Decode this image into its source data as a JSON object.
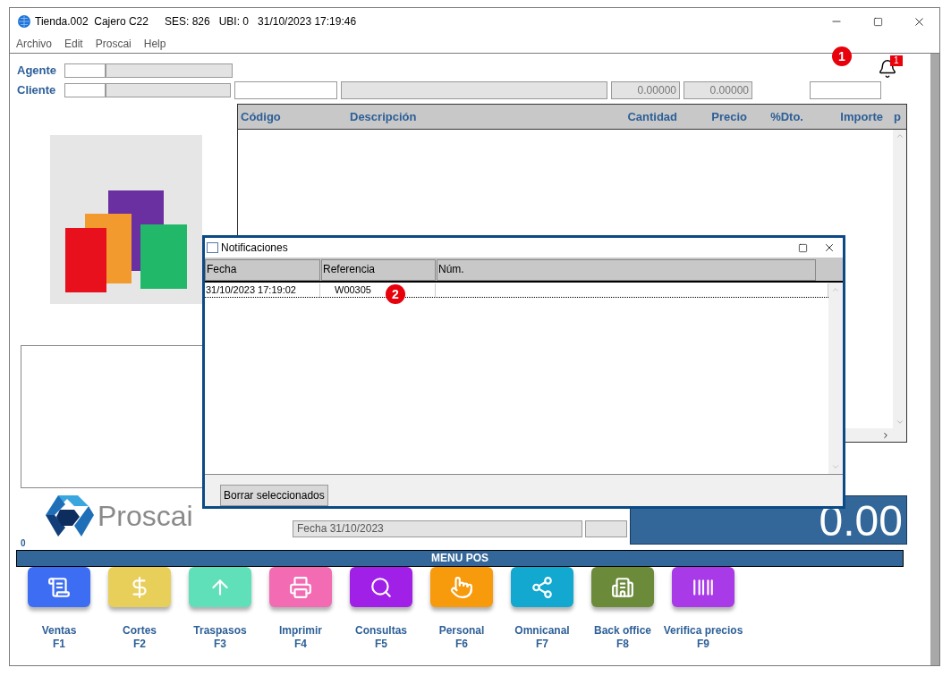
{
  "window": {
    "title": "Tienda.002  Cajero C22",
    "session": "SES: 826",
    "location": "UBI: 0",
    "datetime": "31/10/2023 17:19:46"
  },
  "menu": [
    "Archivo",
    "Edit",
    "Proscai",
    "Help"
  ],
  "notification_badge": "1",
  "callouts": [
    "1",
    "2"
  ],
  "form": {
    "agente_label": "Agente",
    "cliente_label": "Cliente",
    "value_1": "0.00000",
    "value_2": "0.00000"
  },
  "grid": {
    "columns": [
      "Código",
      "Descripción",
      "Cantidad",
      "Precio",
      "%Dto.",
      "Importe",
      "p"
    ]
  },
  "fecha_field": "Fecha 31/10/2023",
  "counter": "0",
  "total": "0.00",
  "logo_text": "Proscai",
  "menu_bar_title": "MENU POS",
  "pos_buttons": [
    {
      "label": "Ventas",
      "key": "F1",
      "color": "#3d6df2"
    },
    {
      "label": "Cortes",
      "key": "F2",
      "color": "#e8cf5a"
    },
    {
      "label": "Traspasos",
      "key": "F3",
      "color": "#5fe0b8"
    },
    {
      "label": "Imprimir",
      "key": "F4",
      "color": "#f26bb3"
    },
    {
      "label": "Consultas",
      "key": "F5",
      "color": "#a020e8"
    },
    {
      "label": "Personal",
      "key": "F6",
      "color": "#f79a0b"
    },
    {
      "label": "Omnicanal",
      "key": "F7",
      "color": "#12a8cf"
    },
    {
      "label": "Back office",
      "key": "F8",
      "color": "#6b8a3a"
    },
    {
      "label": "Verifica precios",
      "key": "F9",
      "color": "#a83ae8"
    }
  ],
  "dialog": {
    "title": "Notificaciones",
    "columns": [
      "Fecha",
      "Referencia",
      "Núm."
    ],
    "rows": [
      {
        "cells": [
          "31/10/2023 17:19:02",
          "W00305",
          ""
        ],
        "selected": true
      }
    ],
    "button": "Borrar seleccionados"
  }
}
